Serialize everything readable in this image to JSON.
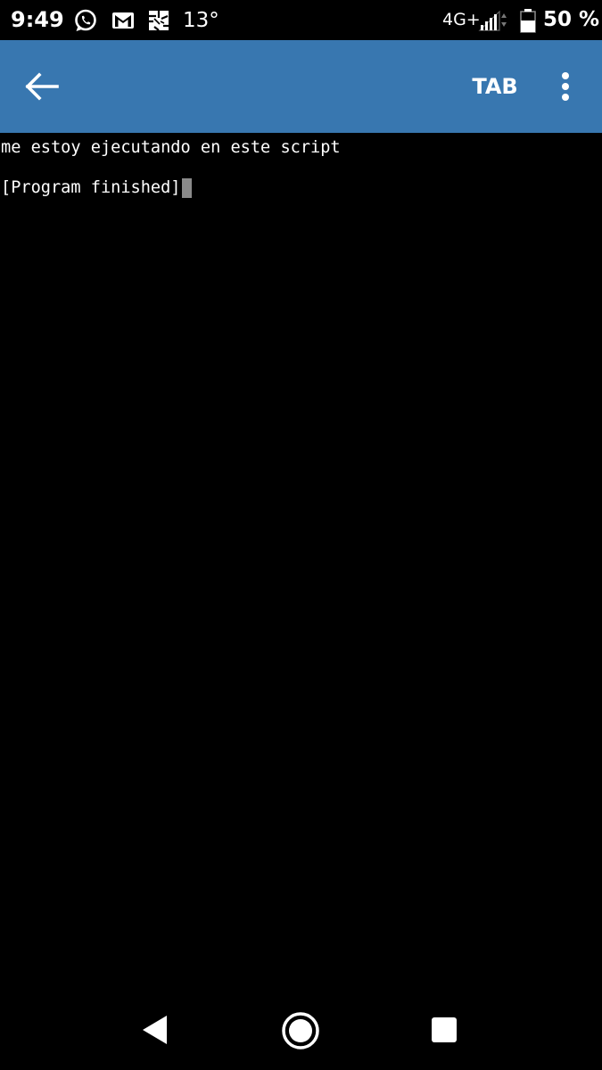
{
  "status_bar": {
    "time": "9:49",
    "temperature": "13°",
    "network": "4G+",
    "battery": "50 %",
    "icons": [
      "whatsapp-icon",
      "gmail-icon",
      "weather-icon",
      "signal-icon",
      "battery-icon"
    ]
  },
  "app_bar": {
    "tab_label": "TAB",
    "color": "#3877b0",
    "icons": [
      "arrow-left-icon",
      "more-vert-icon"
    ]
  },
  "terminal": {
    "lines": [
      "me estoy ejecutando en este script",
      "[Program finished]"
    ]
  },
  "nav_bar": {
    "icons": [
      "triangle-back-icon",
      "circle-home-icon",
      "square-recents-icon"
    ]
  }
}
